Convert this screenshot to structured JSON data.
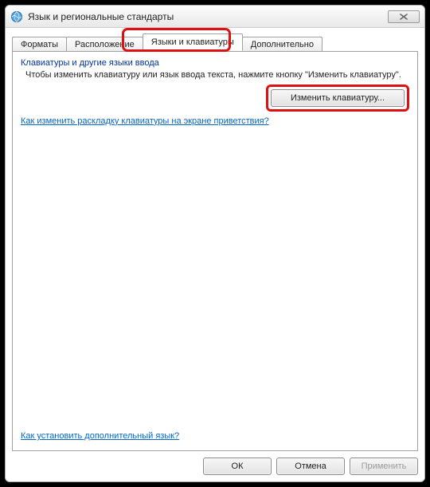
{
  "window": {
    "title": "Язык и региональные стандарты"
  },
  "tabs": {
    "t0": "Форматы",
    "t1": "Расположение",
    "t2": "Языки и клавиатуры",
    "t3": "Дополнительно"
  },
  "group": {
    "title": "Клавиатуры и другие языки ввода",
    "desc": "Чтобы изменить клавиатуру или язык ввода текста, нажмите кнопку \"Изменить клавиатуру\".",
    "changeBtn": "Изменить клавиатуру..."
  },
  "links": {
    "welcome": "Как изменить раскладку клавиатуры на экране приветствия?",
    "install": "Как установить дополнительный язык?"
  },
  "footer": {
    "ok": "ОК",
    "cancel": "Отмена",
    "apply": "Применить"
  }
}
